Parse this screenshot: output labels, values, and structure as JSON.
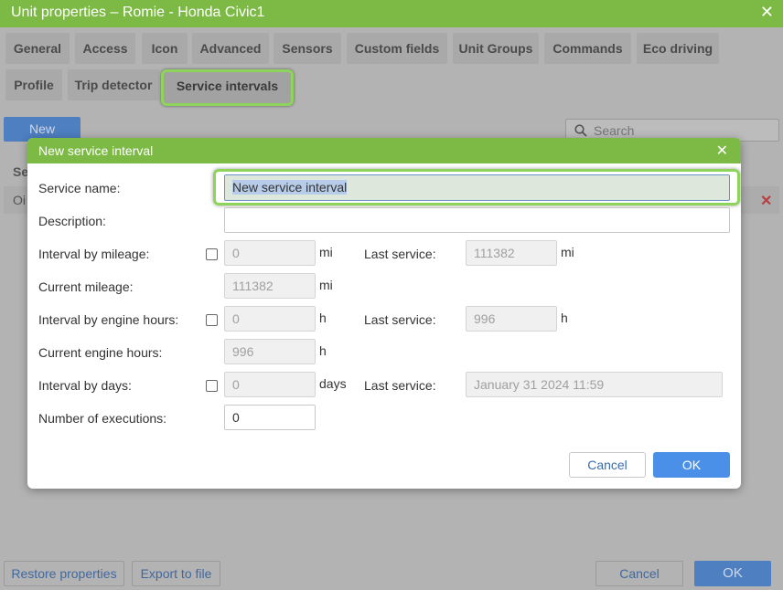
{
  "window": {
    "title": "Unit properties – Romie - Honda Civic1",
    "close_glyph": "✕"
  },
  "tabs": [
    {
      "label": "General"
    },
    {
      "label": "Access"
    },
    {
      "label": "Icon"
    },
    {
      "label": "Advanced"
    },
    {
      "label": "Sensors"
    },
    {
      "label": "Custom fields"
    },
    {
      "label": "Unit Groups"
    },
    {
      "label": "Commands"
    },
    {
      "label": "Eco driving"
    },
    {
      "label": "Profile"
    },
    {
      "label": "Trip detector"
    },
    {
      "label": "Service intervals",
      "active": true
    }
  ],
  "toolbar": {
    "new_label": "New",
    "search_placeholder": "Search"
  },
  "background": {
    "column_fragment": "Se",
    "row_fragment": "Oi",
    "delete_glyph": "✕"
  },
  "footer": {
    "restore_label": "Restore properties",
    "export_label": "Export to file",
    "cancel_label": "Cancel",
    "ok_label": "OK"
  },
  "modal": {
    "title": "New service interval",
    "close_glyph": "✕",
    "service_name": {
      "label": "Service name:",
      "value": "New service interval"
    },
    "description": {
      "label": "Description:",
      "value": ""
    },
    "interval_mileage": {
      "label": "Interval by mileage:",
      "value": "0",
      "unit": "mi",
      "checked": false
    },
    "last_service_mileage": {
      "label": "Last service:",
      "value": "111382",
      "unit": "mi"
    },
    "current_mileage": {
      "label": "Current mileage:",
      "value": "111382",
      "unit": "mi"
    },
    "interval_engine_hours": {
      "label": "Interval by engine hours:",
      "value": "0",
      "unit": "h",
      "checked": false
    },
    "last_service_hours": {
      "label": "Last service:",
      "value": "996",
      "unit": "h"
    },
    "current_engine_hours": {
      "label": "Current engine hours:",
      "value": "996",
      "unit": "h"
    },
    "interval_days": {
      "label": "Interval by days:",
      "value": "0",
      "unit": "days",
      "checked": false
    },
    "last_service_days": {
      "label": "Last service:",
      "value": "January 31 2024 11:59"
    },
    "executions": {
      "label": "Number of executions:",
      "value": "0"
    },
    "cancel_label": "Cancel",
    "ok_label": "OK"
  },
  "colors": {
    "header_green": "#7cba45",
    "highlight_green": "#8fd45a",
    "primary_blue": "#4a90e8"
  }
}
